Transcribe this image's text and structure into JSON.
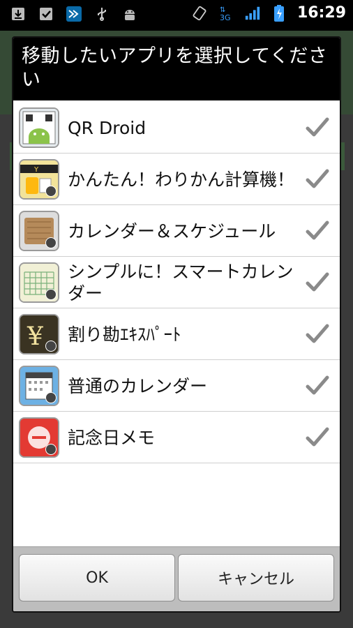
{
  "status_bar": {
    "time": "16:29",
    "network": "3G",
    "left_icons": [
      "download-icon",
      "task-check-icon",
      "app-shortcut-icon",
      "usb-icon",
      "android-debug-icon"
    ],
    "right_icons": [
      "rotate-icon",
      "network-3g-icon",
      "signal-icon",
      "battery-charging-icon"
    ]
  },
  "dialog": {
    "title": "移動したいアプリを選択してください",
    "apps": [
      {
        "name": "QR Droid",
        "checked": true
      },
      {
        "name": "かんたん！わりかん計算機！",
        "checked": true
      },
      {
        "name": "カレンダー＆スケジュール",
        "checked": true
      },
      {
        "name": "シンプルに！スマートカレンダー",
        "checked": true
      },
      {
        "name": "割り勘ｴｷｽﾊﾟｰﾄ",
        "checked": true
      },
      {
        "name": "普通のカレンダー",
        "checked": true
      },
      {
        "name": "記念日メモ",
        "checked": true
      }
    ],
    "ok_label": "OK",
    "cancel_label": "キャンセル"
  }
}
